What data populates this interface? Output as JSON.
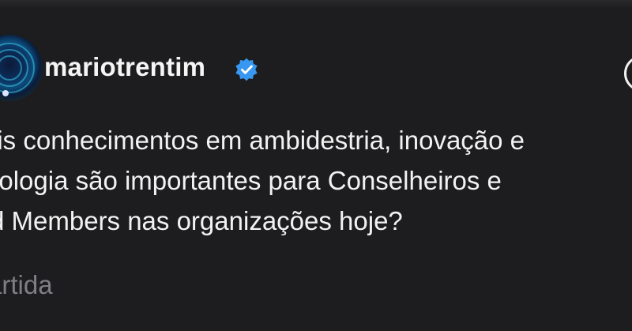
{
  "post": {
    "username": "mariotrentim",
    "verified": true,
    "text_lines": [
      "ais conhecimentos em ambidestria, inovação e",
      "nologia são importantes para Conselheiros e",
      "rd Members nas organizações hoje?"
    ],
    "meta_label": "artida"
  },
  "colors": {
    "background": "#1d1d1f",
    "text": "#f2f2f2",
    "muted": "#7e7e84",
    "verified_badge": "#3897f0"
  },
  "icons": {
    "verified": "verified-badge-icon",
    "avatar": "profile-avatar"
  }
}
